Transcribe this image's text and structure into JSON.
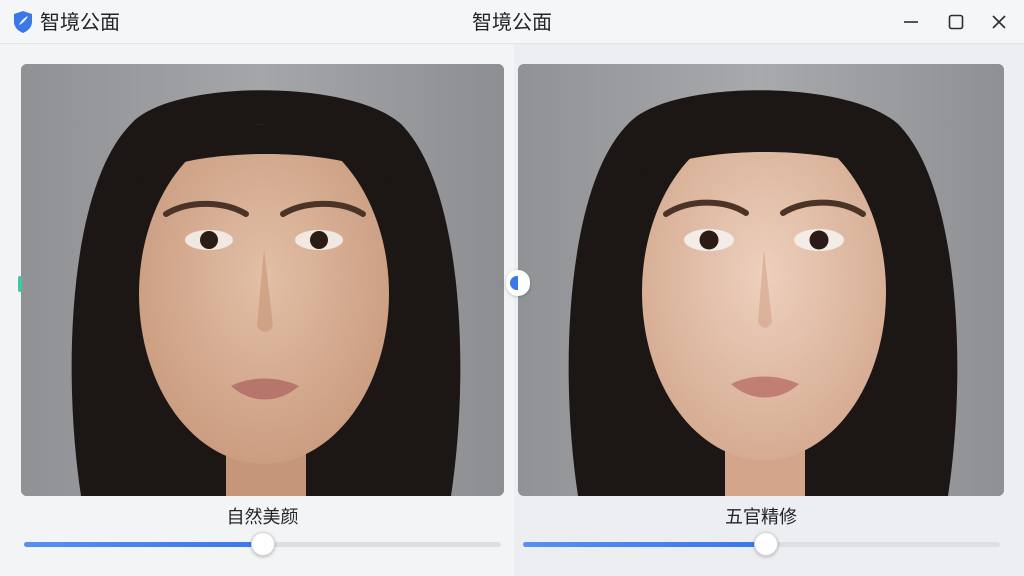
{
  "app": {
    "name": "智境公面",
    "window_title": "智境公面",
    "logo_icon": "shield-feather-icon",
    "accent_color": "#3b78e7"
  },
  "window_controls": {
    "minimize_icon": "minimize-icon",
    "maximize_icon": "maximize-icon",
    "close_icon": "close-icon"
  },
  "panels": [
    {
      "caption": "自然美颜",
      "slider_value": 0.5,
      "image": "portrait-before"
    },
    {
      "caption": "五官精修",
      "slider_value": 0.51,
      "image": "portrait-after"
    }
  ]
}
